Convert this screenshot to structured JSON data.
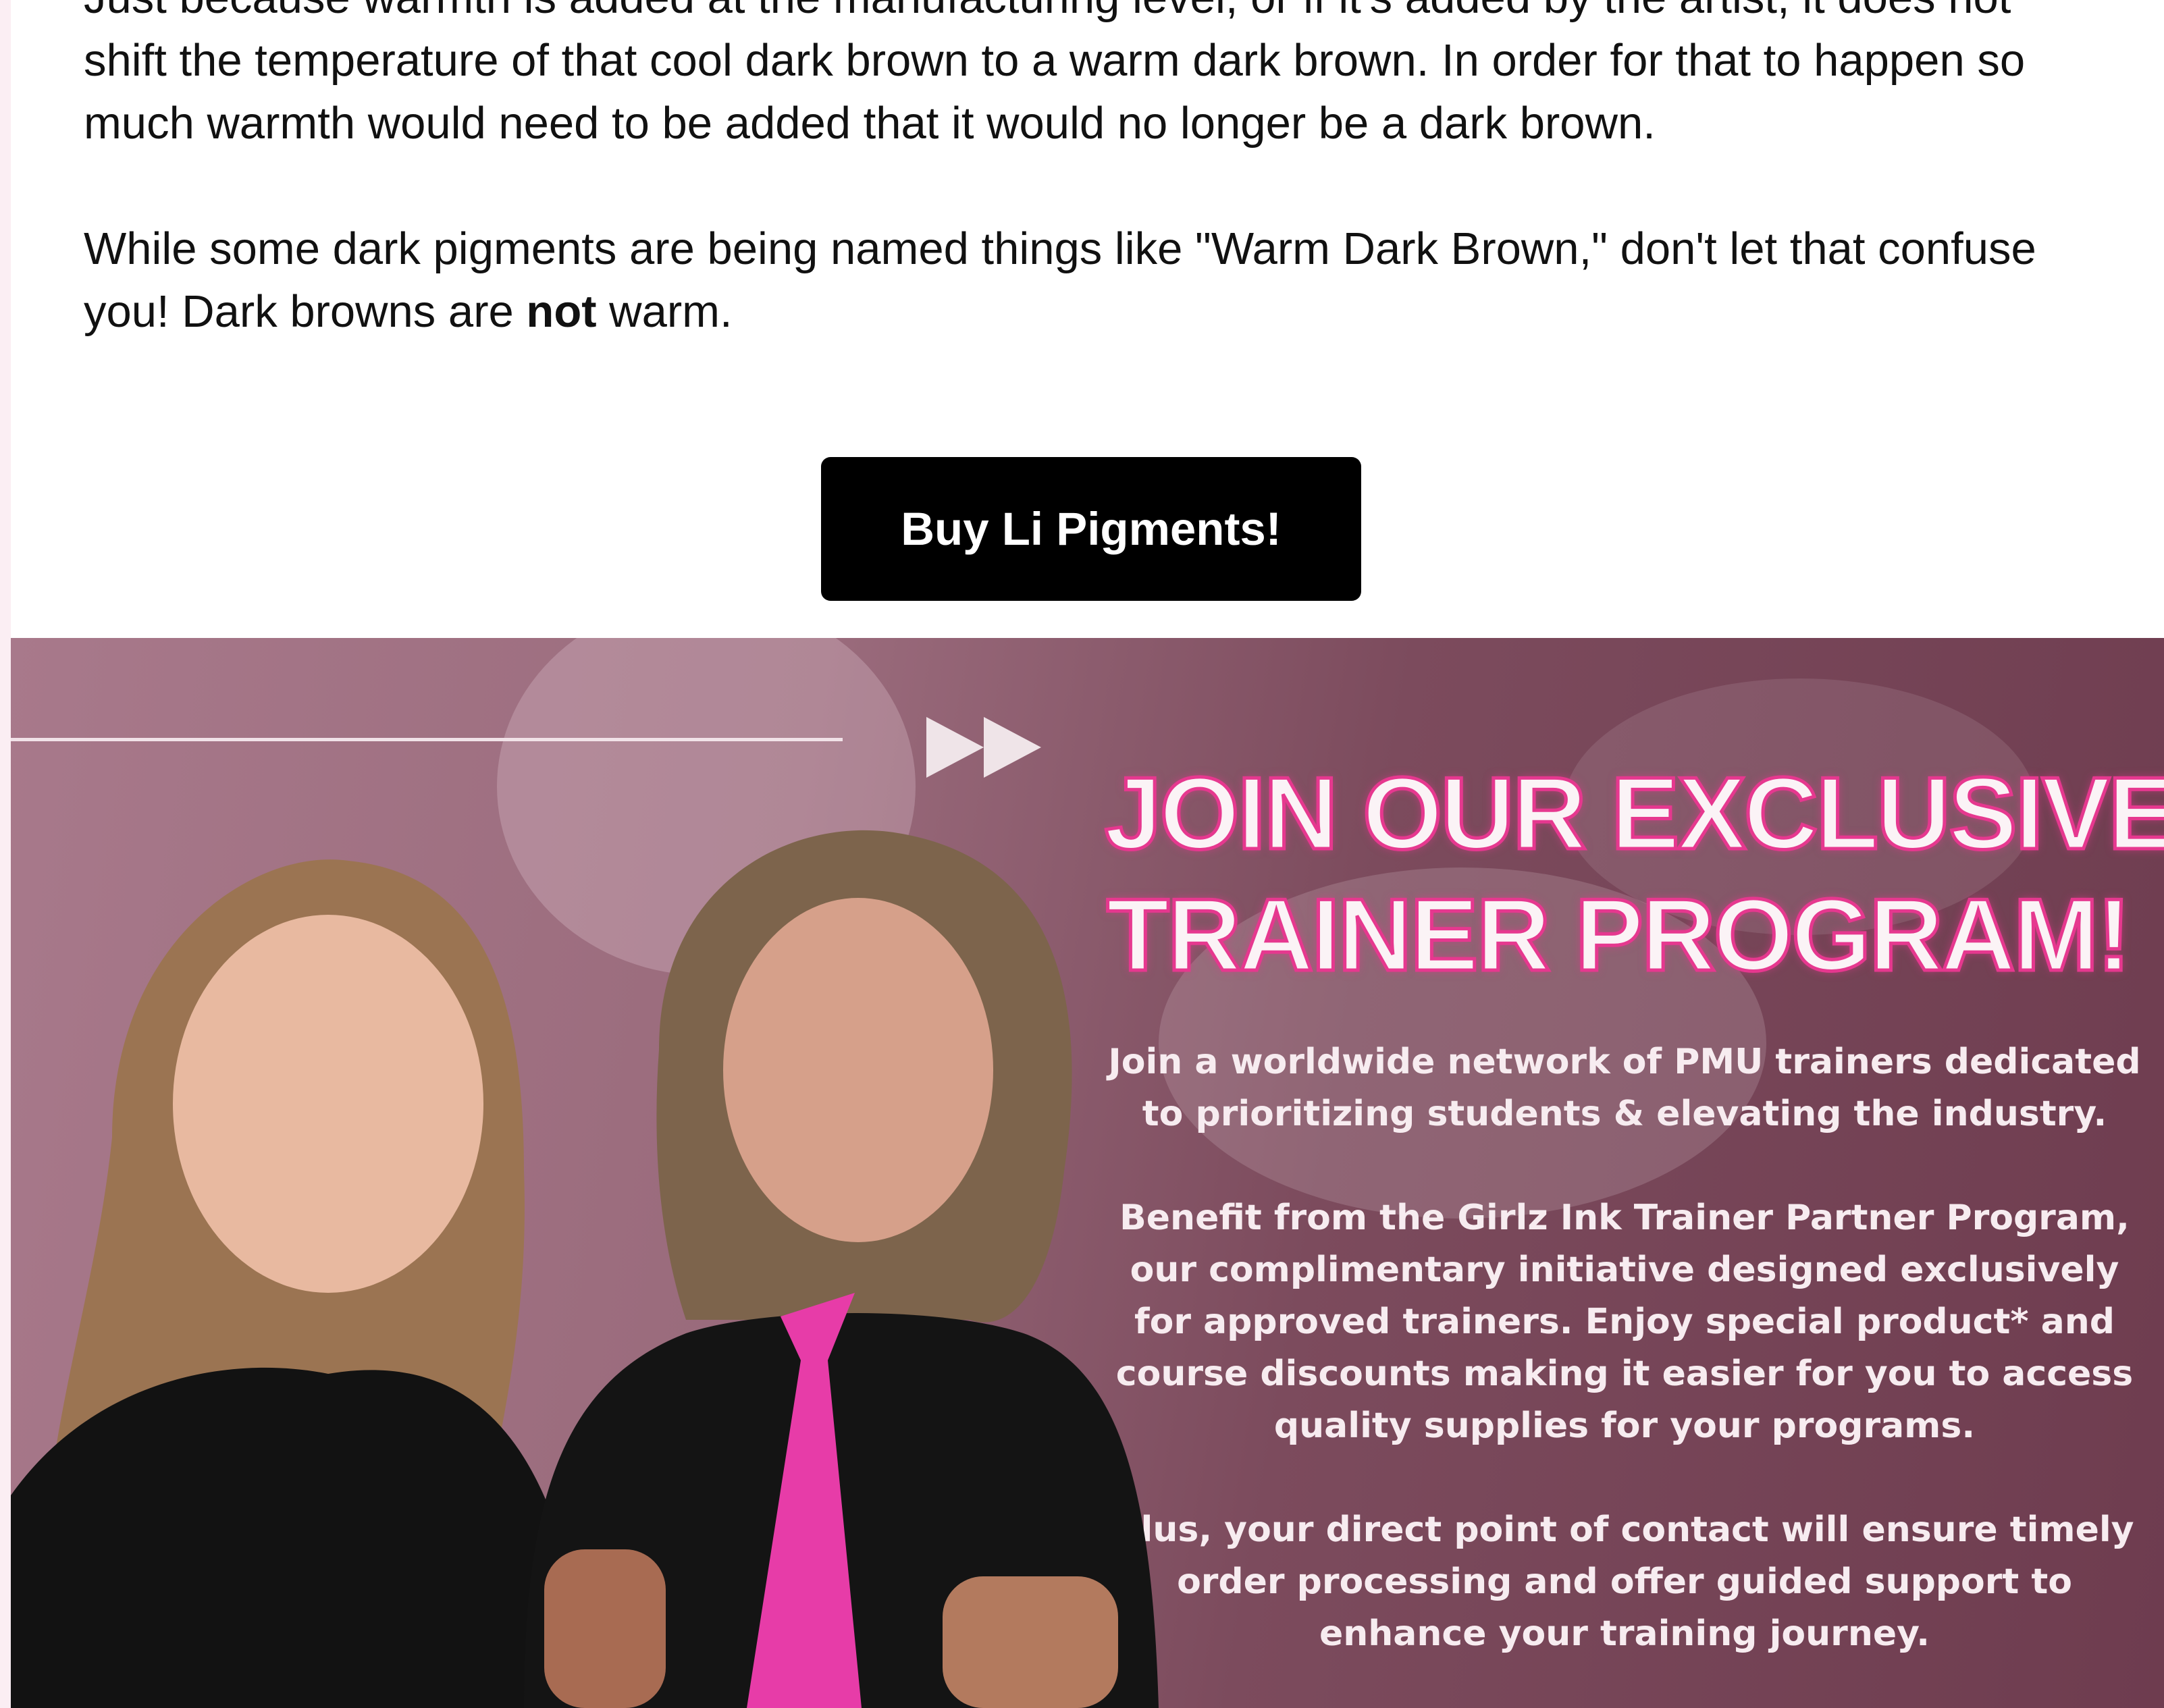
{
  "article": {
    "paragraph1": "Just because warmth is added at the manufacturing level, or if it's added by the artist, it does not shift the temperature of that cool dark brown to a warm dark brown. In order for that to happen so much warmth would need to be added that it would no longer be a dark brown.",
    "paragraph2_before": "While some dark pigments are being named things like \"Warm Dark Brown,\" don't let that confuse you! Dark browns are ",
    "paragraph2_bold": "not",
    "paragraph2_after": " warm."
  },
  "cta": {
    "label": "Buy Li Pigments!"
  },
  "banner": {
    "headline_line1": "JOIN OUR EXCLUSIVE",
    "headline_line2": "TRAINER PROGRAM!",
    "desc1": "Join a worldwide network of PMU trainers dedicated to prioritizing students & elevating the industry.",
    "desc2": "Benefit from the Girlz Ink Trainer Partner Program, our complimentary initiative designed exclusively for approved trainers. Enjoy special product* and course discounts making it easier for you to access quality supplies for your programs.",
    "desc3": "Plus, your direct point of contact will ensure timely order processing and offer guided support to enhance your training journey."
  },
  "colors": {
    "accent_pink": "#e6388f",
    "banner_mauve": "#8a5a6c",
    "cta_bg": "#000000"
  },
  "icons": [
    "fast-forward-icon"
  ]
}
